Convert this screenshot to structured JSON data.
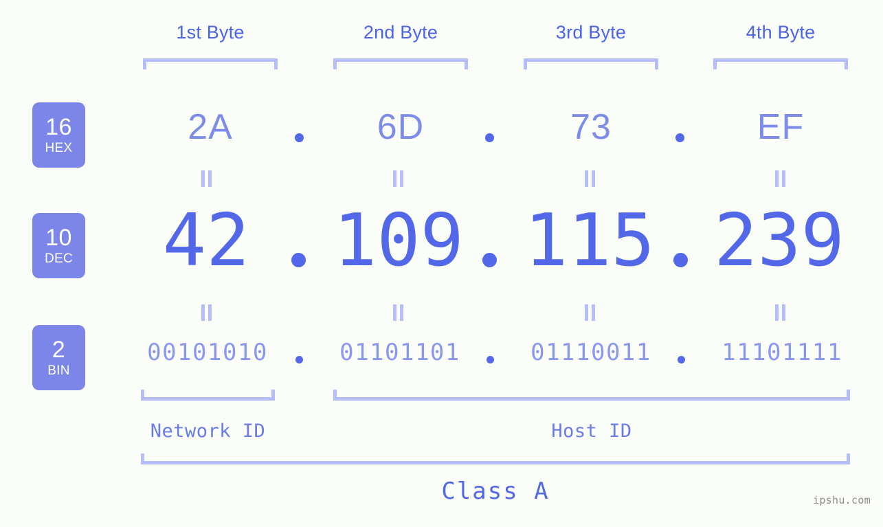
{
  "background_color": "#fbfdf8",
  "colors": {
    "header_blue": "#4a63e8",
    "badge_fill": "#7b86e8",
    "bracket": "#b5bdfb",
    "hex_text": "#7d8ce8",
    "dec_text": "#5268e8",
    "bin_text": "#8a97ee",
    "dot": "#5268e8",
    "caption": "#6a7be8",
    "watermark": "#8c8c8c"
  },
  "byte_headers": [
    {
      "label": "1st Byte"
    },
    {
      "label": "2nd Byte"
    },
    {
      "label": "3rd Byte"
    },
    {
      "label": "4th Byte"
    }
  ],
  "rows": {
    "hex": {
      "badge_number": "16",
      "badge_name": "HEX",
      "values": [
        "2A",
        "6D",
        "73",
        "EF"
      ],
      "separator": "."
    },
    "dec": {
      "badge_number": "10",
      "badge_name": "DEC",
      "values": [
        "42",
        "109",
        "115",
        "239"
      ],
      "separator": "."
    },
    "bin": {
      "badge_number": "2",
      "badge_name": "BIN",
      "values": [
        "00101010",
        "01101101",
        "01110011",
        "11101111"
      ],
      "separator": "."
    }
  },
  "equals_symbol": "=",
  "footer": {
    "network_id_label": "Network ID",
    "host_id_label": "Host ID",
    "class_label": "Class A"
  },
  "watermark": "ipshu.com"
}
